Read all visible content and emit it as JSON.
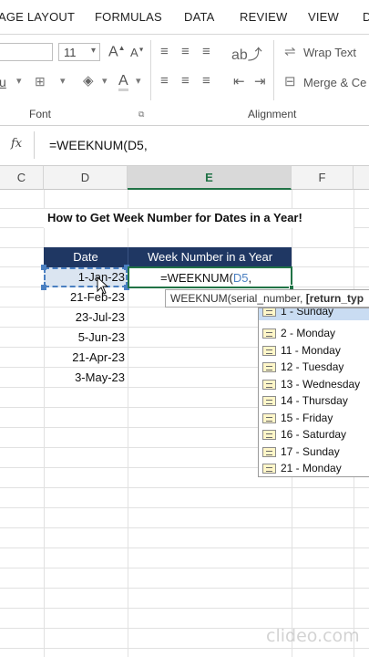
{
  "tabs": [
    "AGE LAYOUT",
    "FORMULAS",
    "DATA",
    "REVIEW",
    "VIEW",
    "D"
  ],
  "ribbon": {
    "font_size": "11",
    "wrap_text": "Wrap Text",
    "merge_center": "Merge & Ce",
    "font_group": "Font",
    "alignment_group": "Alignment",
    "grow_font": "A",
    "shrink_font": "A",
    "font_color_letter": "A",
    "underline_partial": "u"
  },
  "formula_bar": {
    "fx_label": "fx",
    "formula": "=WEEKNUM(D5,"
  },
  "columns": [
    "C",
    "D",
    "E",
    "F"
  ],
  "sheet": {
    "title": "How to Get Week Number for Dates in a Year!",
    "header_date": "Date",
    "header_week": "Week Number in a Year",
    "dates": [
      "1-Jan-23",
      "21-Feb-23",
      "23-Jul-23",
      "5-Jun-23",
      "21-Apr-23",
      "3-May-23"
    ],
    "active_formula_prefix": "=WEEKNUM(",
    "active_formula_ref": "D5",
    "active_formula_suffix": ","
  },
  "tooltip": {
    "fn": "WEEKNUM(serial_number, ",
    "arg": "[return_typ"
  },
  "dropdown_options": [
    "1 - Sunday",
    "2 - Monday",
    "11 - Monday",
    "12 - Tuesday",
    "13 - Wednesday",
    "14 - Thursday",
    "15 - Friday",
    "16 - Saturday",
    "17 - Sunday",
    "21 - Monday"
  ],
  "watermark": "clideo.com",
  "colors": {
    "header_fill": "#1f3763",
    "selection_green": "#217346",
    "selected_cell_fill": "#dbe5f1",
    "reference_blue": "#4a7fc1",
    "dropdown_highlight": "#c9dcf2"
  }
}
